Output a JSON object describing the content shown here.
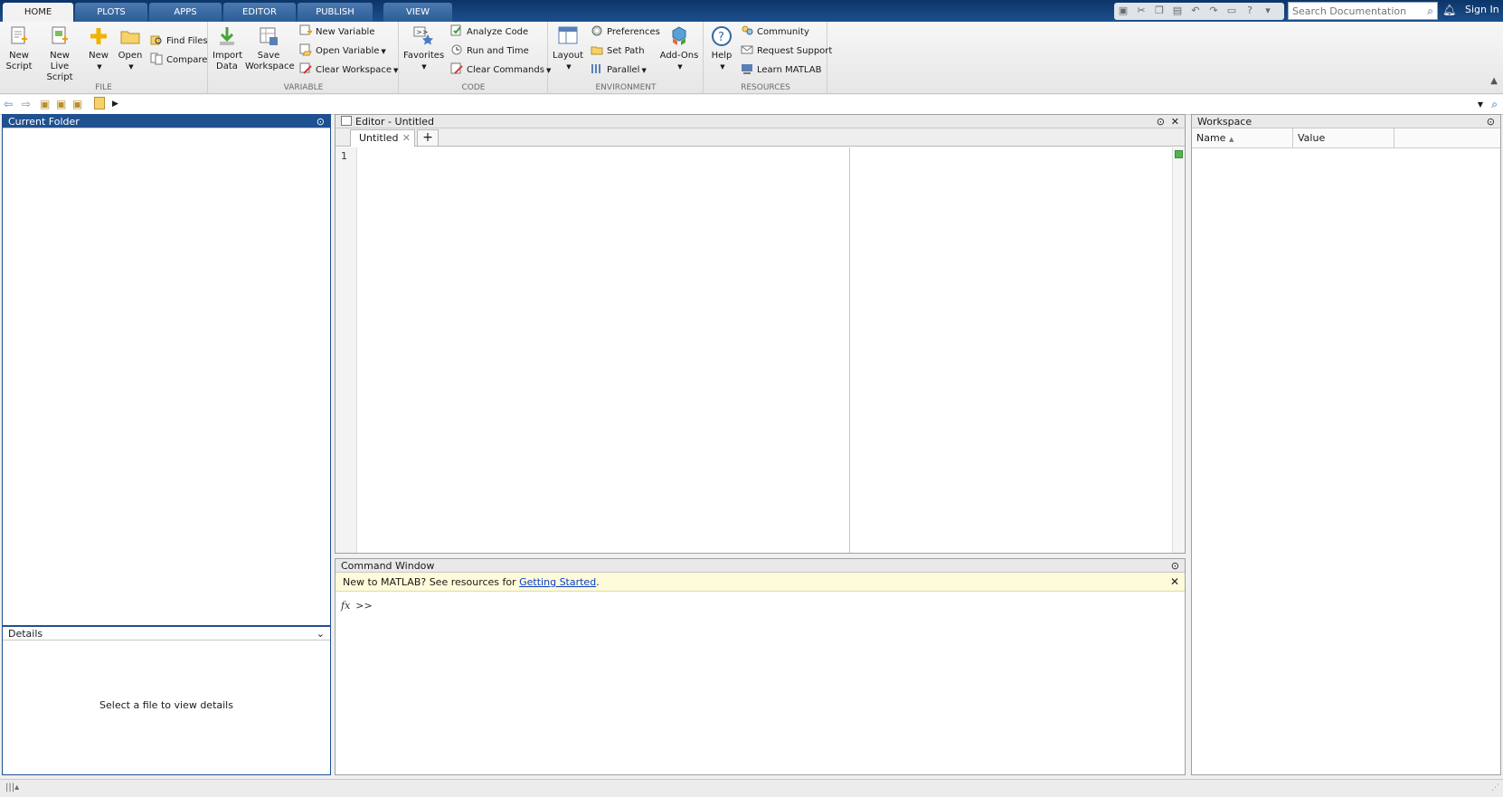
{
  "tabs": [
    "HOME",
    "PLOTS",
    "APPS",
    "EDITOR",
    "PUBLISH",
    "VIEW"
  ],
  "search": {
    "placeholder": "Search Documentation"
  },
  "sign_in": "Sign In",
  "ribbon": {
    "file": {
      "label": "FILE",
      "new_script": "New\nScript",
      "new_script_l1": "New",
      "new_script_l2": "Script",
      "new_live_l1": "New",
      "new_live_l2": "Live Script",
      "new": "New",
      "open": "Open",
      "find_files": "Find Files",
      "compare": "Compare"
    },
    "variable": {
      "label": "VARIABLE",
      "import_l1": "Import",
      "import_l2": "Data",
      "save_l1": "Save",
      "save_l2": "Workspace",
      "new_variable": "New Variable",
      "open_variable": "Open Variable",
      "clear_workspace": "Clear Workspace"
    },
    "code": {
      "label": "CODE",
      "favorites": "Favorites",
      "analyze_code": "Analyze Code",
      "run_and_time": "Run and Time",
      "clear_commands": "Clear Commands"
    },
    "environment": {
      "label": "ENVIRONMENT",
      "layout": "Layout",
      "preferences": "Preferences",
      "set_path": "Set Path",
      "parallel": "Parallel",
      "add_ons": "Add-Ons"
    },
    "resources": {
      "label": "RESOURCES",
      "help": "Help",
      "community": "Community",
      "request_support": "Request Support",
      "learn_matlab": "Learn MATLAB"
    }
  },
  "current_folder": {
    "title": "Current Folder"
  },
  "details": {
    "title": "Details",
    "empty": "Select a file to view details"
  },
  "editor": {
    "title": "Editor - Untitled",
    "tab": "Untitled",
    "line_number": "1"
  },
  "command_window": {
    "title": "Command Window",
    "notice_prefix": "New to MATLAB? See resources for ",
    "notice_link": "Getting Started",
    "notice_suffix": ".",
    "prompt": ">>",
    "fx": "fx"
  },
  "workspace": {
    "title": "Workspace",
    "col_name": "Name",
    "col_value": "Value"
  }
}
